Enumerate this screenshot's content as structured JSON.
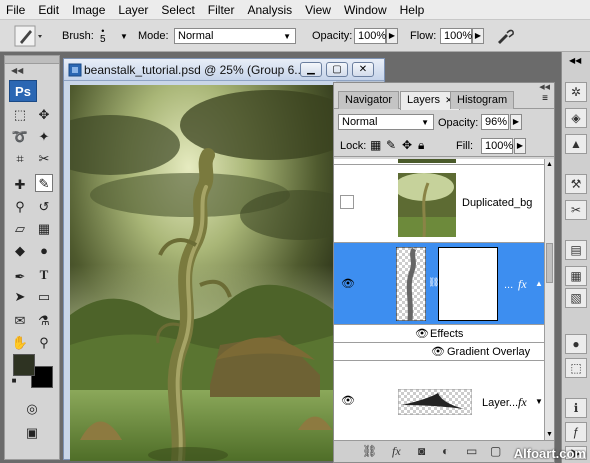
{
  "menubar": {
    "items": [
      "File",
      "Edit",
      "Image",
      "Layer",
      "Select",
      "Filter",
      "Analysis",
      "View",
      "Window",
      "Help"
    ]
  },
  "options_bar": {
    "brush_label": "Brush:",
    "brush_size": "5",
    "mode_label": "Mode:",
    "mode_value": "Normal",
    "opacity_label": "Opacity:",
    "opacity_value": "100%",
    "flow_label": "Flow:",
    "flow_value": "100%"
  },
  "toolbox": {
    "logo": "Ps"
  },
  "document": {
    "title": "beanstalk_tutorial.psd @ 25% (Group 6..."
  },
  "layers_panel": {
    "tabs": [
      "Navigator",
      "Layers",
      "Histogram"
    ],
    "active_tab": "Layers",
    "blend_mode": "Normal",
    "opacity_label": "Opacity:",
    "opacity_value": "96%",
    "lock_label": "Lock:",
    "fill_label": "Fill:",
    "fill_value": "100%",
    "layers": [
      {
        "name": "Duplicated_bg",
        "visible": false
      },
      {
        "name": "...",
        "visible": true,
        "selected": true,
        "fx": "fx"
      },
      {
        "name": "Layer...",
        "visible": true,
        "fx": "fx"
      }
    ],
    "effects_label": "Effects",
    "effect_item": "Gradient Overlay"
  },
  "watermark": "Alfoart.com",
  "colors": {
    "selection_blue": "#3d8ef0",
    "ps_logo": "#2b67b3",
    "foreground": "#2e3322",
    "background": "#000000"
  }
}
